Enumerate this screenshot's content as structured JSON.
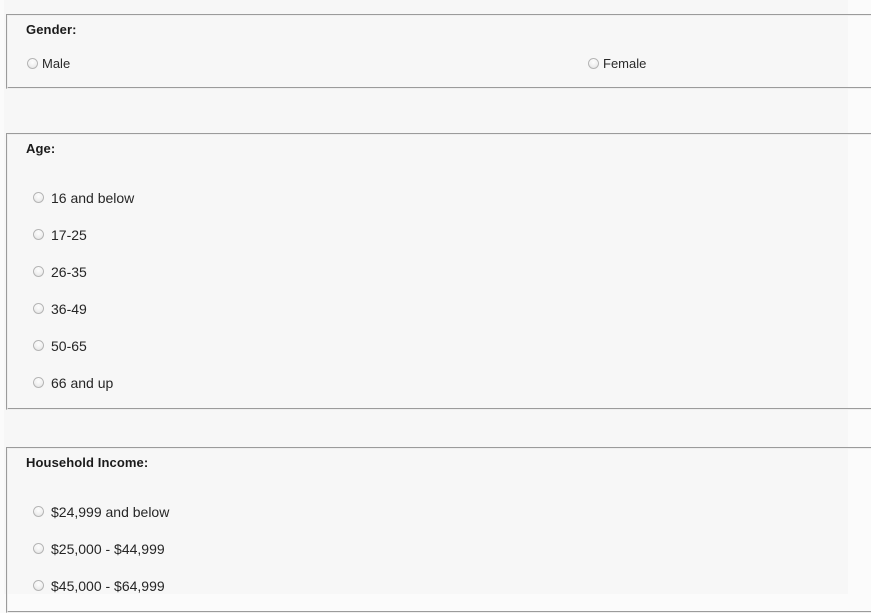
{
  "form": {
    "background_color": "#f7f7f7",
    "page_color": "#fbfbfb",
    "heading_color": "#1b1b1b",
    "label_color": "#262626",
    "groups": [
      {
        "name": "gender",
        "heading": "Gender:",
        "layout": "inline",
        "options": [
          {
            "label": "Male",
            "value": "male",
            "selected": false
          },
          {
            "label": "Female",
            "value": "female",
            "selected": false
          }
        ]
      },
      {
        "name": "age",
        "heading": "Age:",
        "layout": "stacked",
        "options": [
          {
            "label": "16 and below",
            "value": "16-and-below",
            "selected": false
          },
          {
            "label": "17-25",
            "value": "17-25",
            "selected": false
          },
          {
            "label": "26-35",
            "value": "26-35",
            "selected": false
          },
          {
            "label": "36-49",
            "value": "36-49",
            "selected": false
          },
          {
            "label": "50-65",
            "value": "50-65",
            "selected": false
          },
          {
            "label": "66 and up",
            "value": "66-and-up",
            "selected": false
          }
        ]
      },
      {
        "name": "household-income",
        "heading": "Household Income:",
        "layout": "stacked",
        "options": [
          {
            "label": "$24,999 and below",
            "value": "24999-and-below",
            "selected": false
          },
          {
            "label": "$25,000 - $44,999",
            "value": "25000-44999",
            "selected": false
          },
          {
            "label": "$45,000 - $64,999",
            "value": "45000-64999",
            "selected": false
          }
        ]
      }
    ]
  }
}
